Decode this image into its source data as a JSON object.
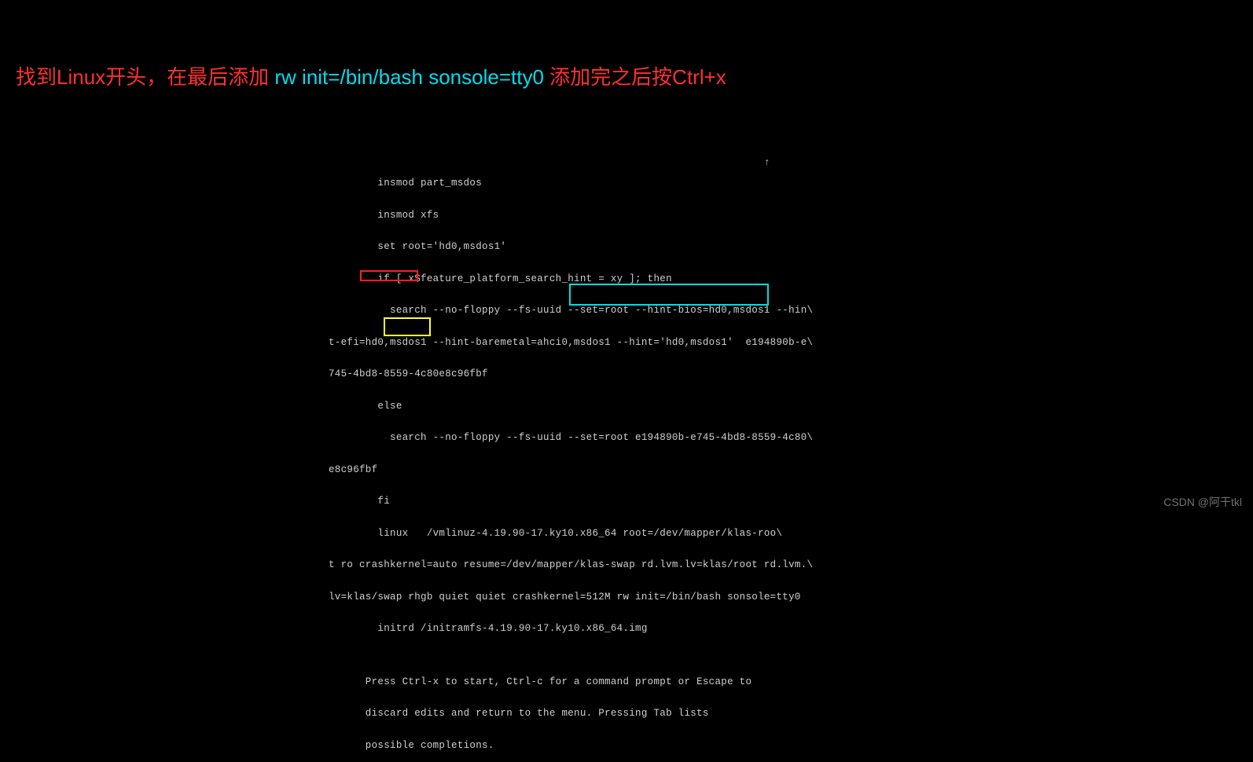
{
  "annotation": {
    "part1_red": "找到Linux开头，在最后添加 ",
    "part2_cyan": "rw init=/bin/bash sonsole=tty0",
    "spacer": "      ",
    "part3_red": "添加完之后按Ctrl+x"
  },
  "terminal": {
    "lines": [
      "        insmod part_msdos",
      "        insmod xfs",
      "        set root='hd0,msdos1'",
      "        if [ x$feature_platform_search_hint = xy ]; then",
      "          search --no-floppy --fs-uuid --set=root --hint-bios=hd0,msdos1 --hin\\",
      "t-efi=hd0,msdos1 --hint-baremetal=ahci0,msdos1 --hint='hd0,msdos1'  e194890b-e\\",
      "745-4bd8-8559-4c80e8c96fbf",
      "        else",
      "          search --no-floppy --fs-uuid --set=root e194890b-e745-4bd8-8559-4c80\\",
      "e8c96fbf",
      "        fi",
      "        linux   /vmlinuz-4.19.90-17.ky10.x86_64 root=/dev/mapper/klas-roo\\",
      "t ro crashkernel=auto resume=/dev/mapper/klas-swap rd.lvm.lv=klas/root rd.lvm.\\",
      "lv=klas/swap rhgb quiet quiet crashkernel=512M rw init=/bin/bash sonsole=tty0",
      "        initrd /initramfs-4.19.90-17.ky10.x86_64.img",
      "",
      "      Press Ctrl-x to start, Ctrl-c for a command prompt or Escape to",
      "      discard edits and return to the menu. Pressing Tab lists",
      "      possible completions."
    ],
    "arrow_up": "↑",
    "arrow_down": "↓"
  },
  "watermark": "CSDN @阿干tkl"
}
